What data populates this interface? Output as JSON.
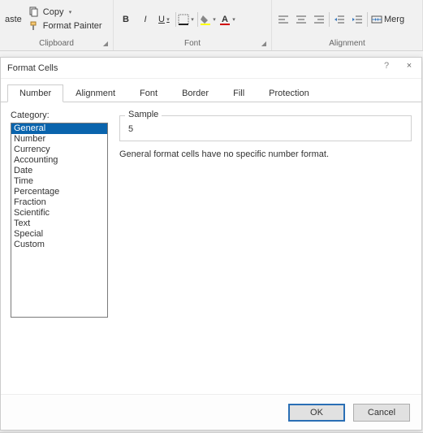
{
  "ribbon": {
    "clipboard": {
      "paste": "aste",
      "copy": "Copy",
      "format_painter": "Format Painter",
      "group_label": "Clipboard"
    },
    "font": {
      "bold": "B",
      "italic": "I",
      "underline": "U",
      "group_label": "Font"
    },
    "alignment": {
      "merge": "Merg",
      "group_label": "Alignment"
    }
  },
  "dialog": {
    "title": "Format Cells",
    "help": "?",
    "close": "×",
    "tabs": [
      "Number",
      "Alignment",
      "Font",
      "Border",
      "Fill",
      "Protection"
    ],
    "active_tab": 0,
    "category_label": "Category:",
    "categories": [
      "General",
      "Number",
      "Currency",
      "Accounting",
      "Date",
      "Time",
      "Percentage",
      "Fraction",
      "Scientific",
      "Text",
      "Special",
      "Custom"
    ],
    "selected_category": 0,
    "sample_label": "Sample",
    "sample_value": "5",
    "description": "General format cells have no specific number format.",
    "ok": "OK",
    "cancel": "Cancel"
  }
}
